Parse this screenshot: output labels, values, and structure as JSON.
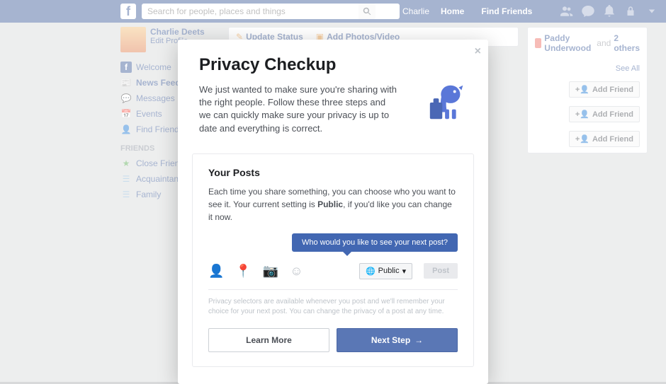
{
  "search_placeholder": "Search for people, places and things",
  "top_user": "Charlie",
  "top_links": {
    "home": "Home",
    "find": "Find Friends"
  },
  "profile": {
    "name": "Charlie Deets",
    "edit": "Edit Profile"
  },
  "nav": {
    "welcome": "Welcome",
    "feed": "News Feed",
    "messages": "Messages",
    "events": "Events",
    "find": "Find Friends",
    "friends_head": "Friends",
    "close": "Close Friends",
    "acq": "Acquaintances",
    "family": "Family"
  },
  "composer": {
    "status": "Update Status",
    "photos": "Add Photos/Video"
  },
  "pymk": {
    "name": "Paddy Underwood",
    "and": "and",
    "others": "2 others",
    "see_all": "See All",
    "add": "Add Friend"
  },
  "modal": {
    "title": "Privacy Checkup",
    "intro": "We just wanted to make sure you're sharing with the right people. Follow these three steps and we can quickly make sure your privacy is up to date and everything is correct.",
    "posts_title": "Your Posts",
    "posts_body_a": "Each time you share something, you can choose who you want to see it. Your current setting is ",
    "posts_body_b": "Public",
    "posts_body_c": ", if you'd like you can change it now.",
    "tooltip": "Who would you like to see your next post?",
    "audience": "Public",
    "post": "Post",
    "fineprint": "Privacy selectors are available whenever you post and we'll remember your choice for your next post. You can change the privacy of a post at any time.",
    "learn": "Learn More",
    "next": "Next Step"
  }
}
